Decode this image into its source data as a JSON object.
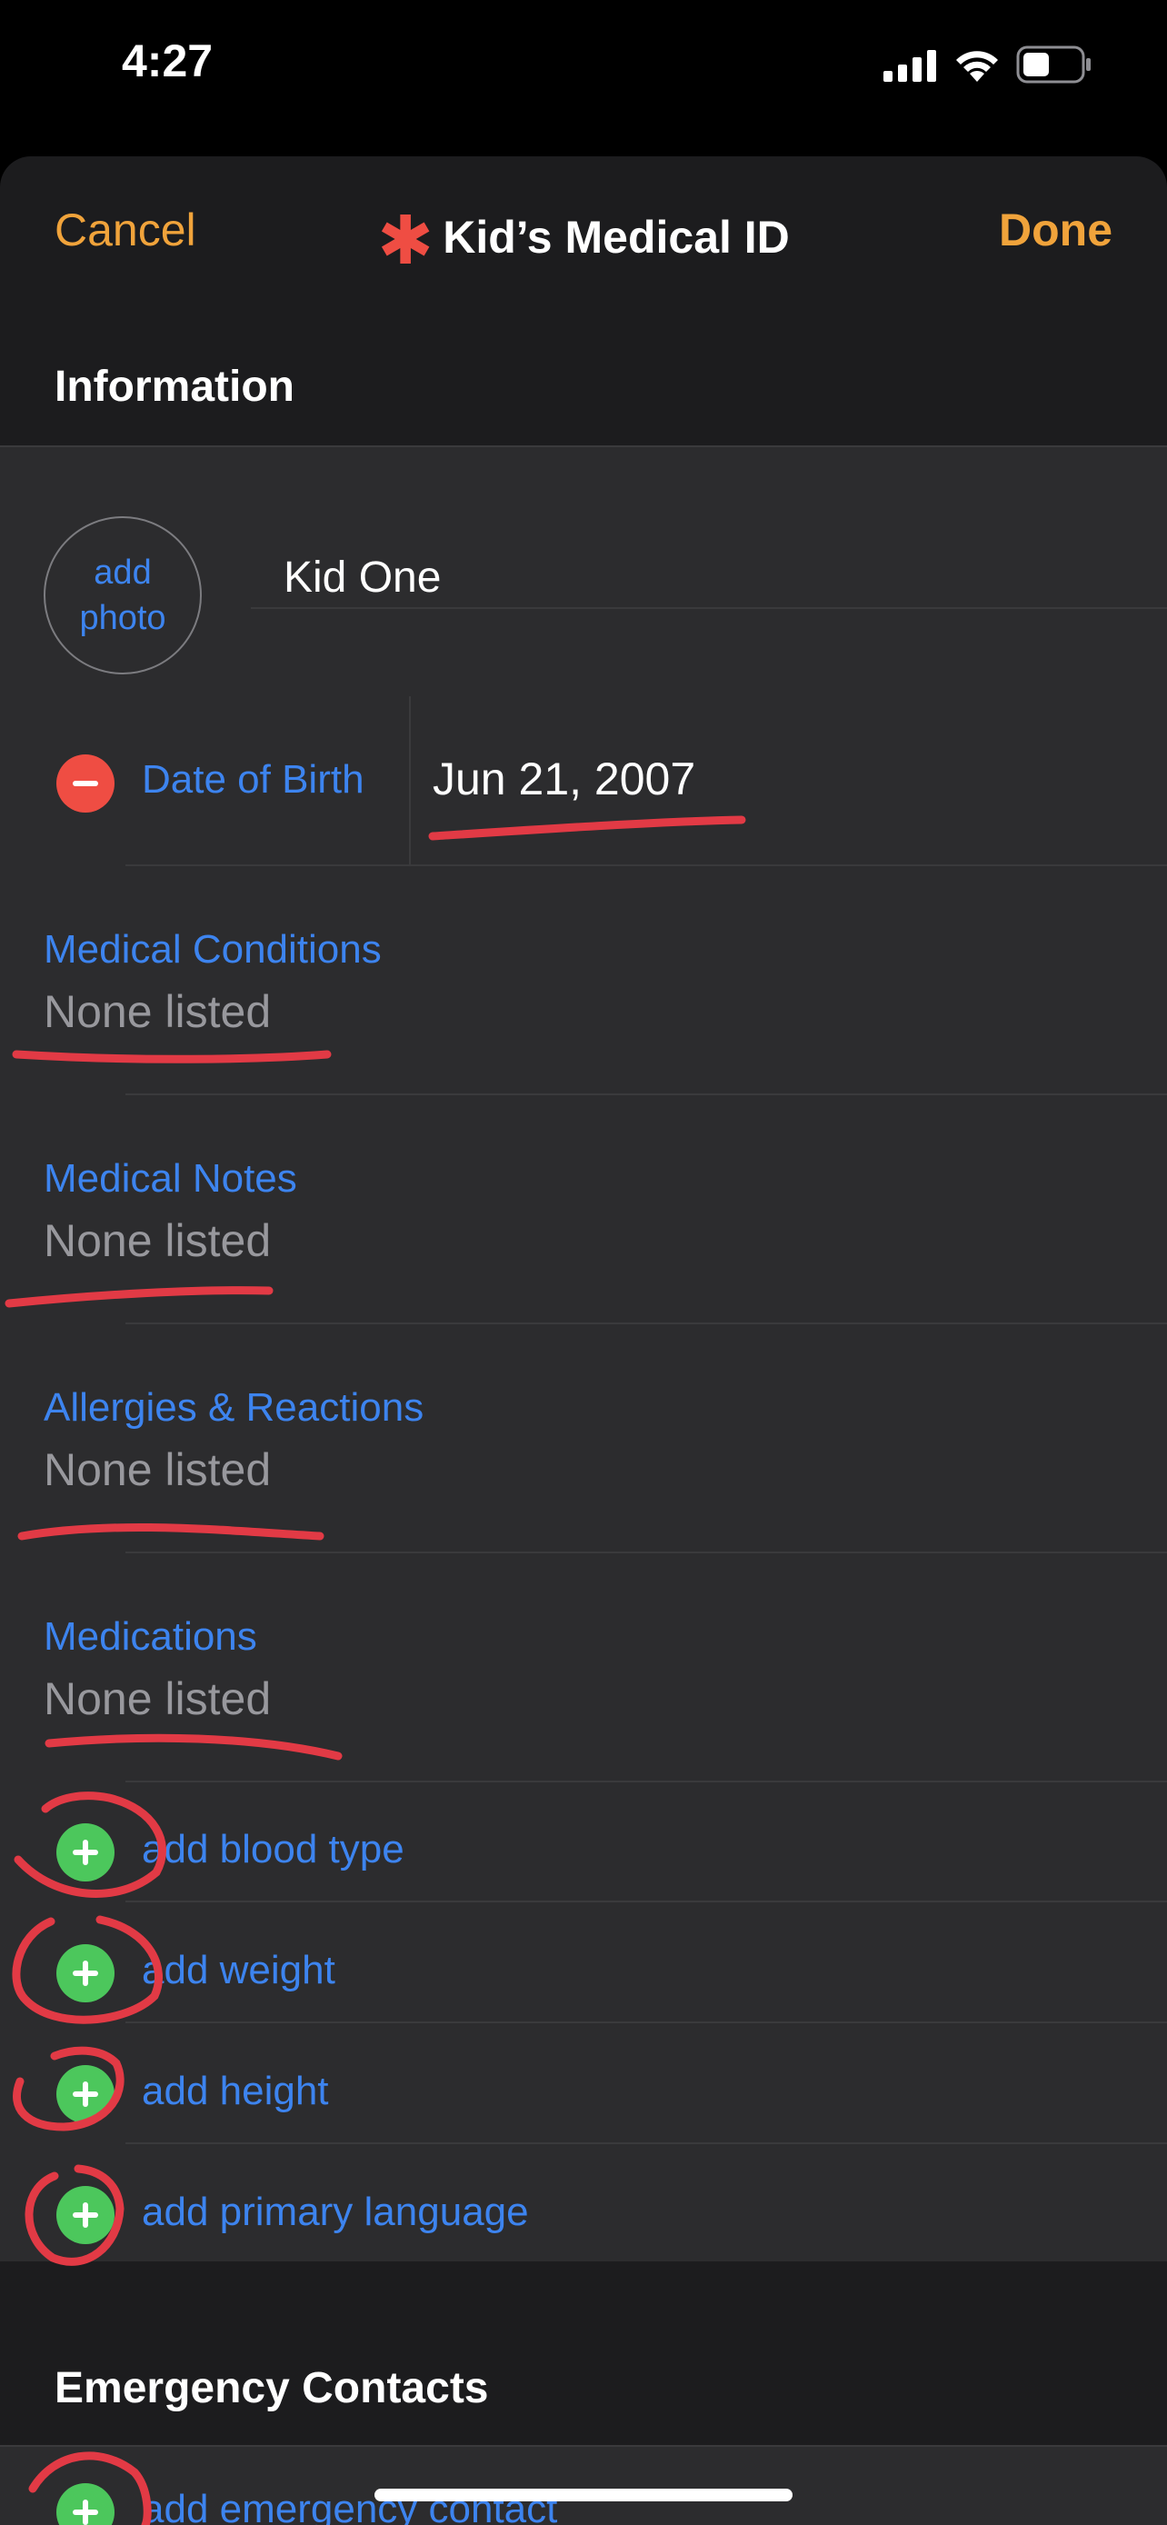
{
  "status_bar": {
    "time": "4:27"
  },
  "nav": {
    "cancel_label": "Cancel",
    "title": "Kid’s Medical ID",
    "done_label": "Done",
    "accent": "#f0a33b",
    "title_icon": "asterisk-icon"
  },
  "information": {
    "header": "Information",
    "photo_label": "add\nphoto",
    "name": "Kid One",
    "dob_label": "Date of Birth",
    "dob_value": "Jun 21, 2007",
    "fields": [
      {
        "label": "Medical Conditions",
        "value": "None listed"
      },
      {
        "label": "Medical Notes",
        "value": "None listed"
      },
      {
        "label": "Allergies & Reactions",
        "value": "None listed"
      },
      {
        "label": "Medications",
        "value": "None listed"
      }
    ],
    "add_rows": [
      {
        "label": "add blood type"
      },
      {
        "label": "add weight"
      },
      {
        "label": "add height"
      },
      {
        "label": "add primary language"
      }
    ]
  },
  "emergency_contacts": {
    "header": "Emergency Contacts",
    "add_label": "add emergency contact"
  },
  "colors": {
    "link": "#3d84ef",
    "add": "#4cc75c",
    "remove": "#ef4d43",
    "annotation": "#e23a45"
  }
}
